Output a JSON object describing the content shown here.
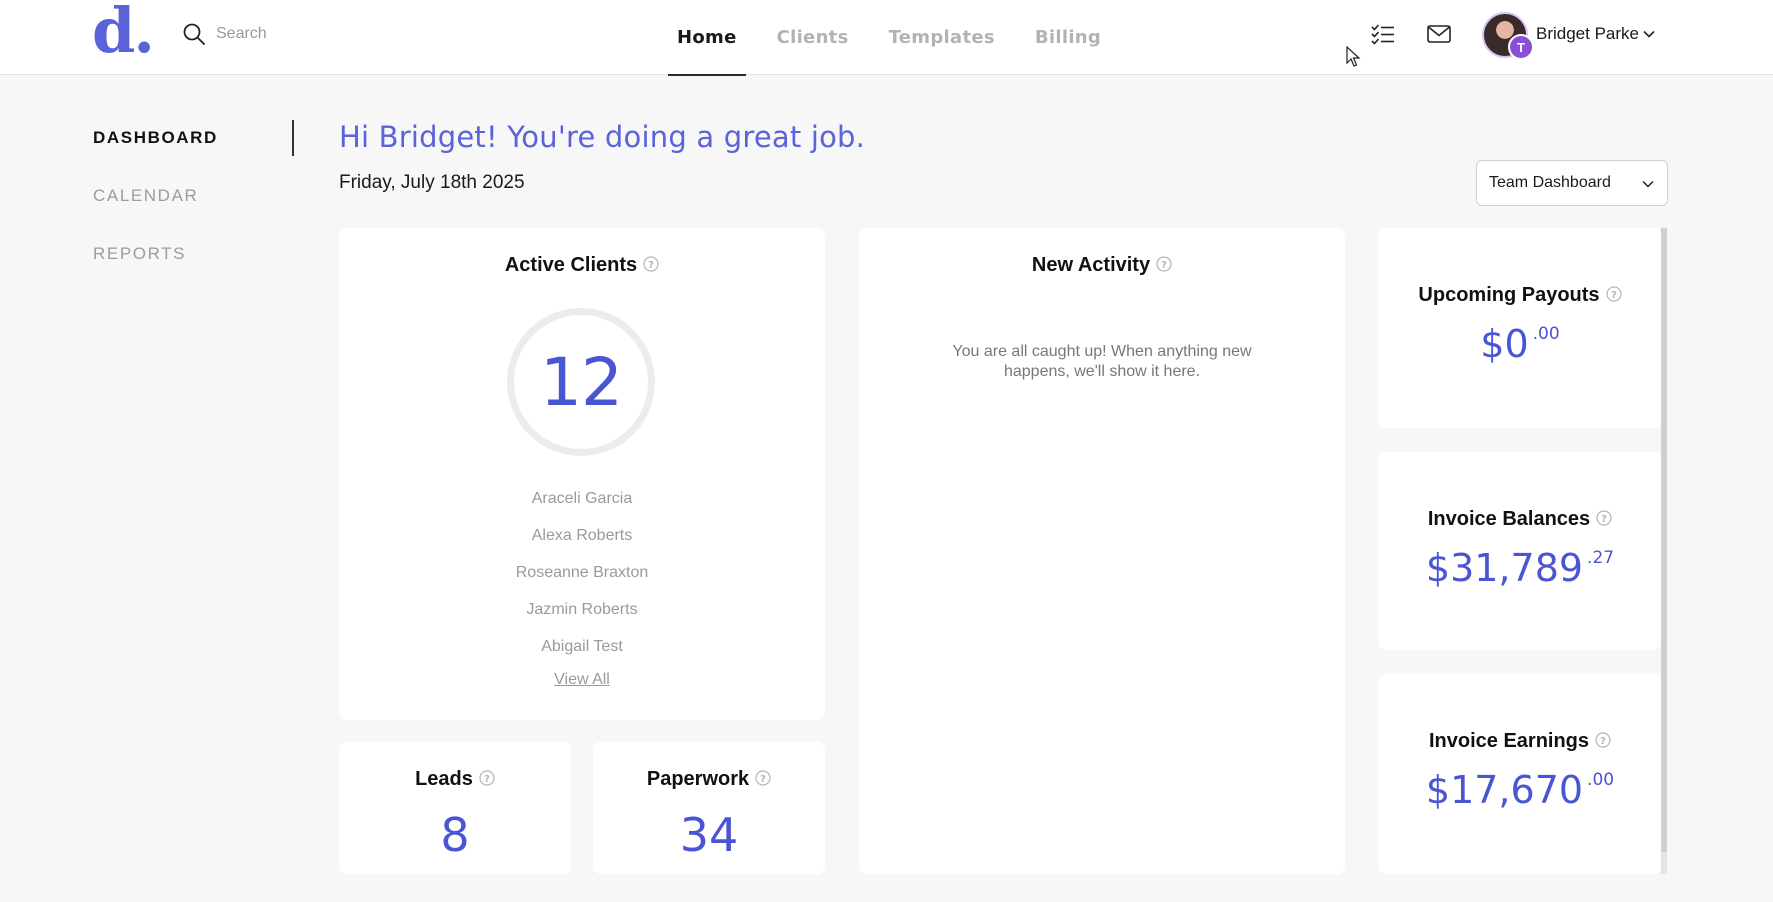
{
  "header": {
    "logo": "d.",
    "search": {
      "placeholder": "Search",
      "value": ""
    },
    "tabs": [
      {
        "label": "Home",
        "active": true
      },
      {
        "label": "Clients",
        "active": false
      },
      {
        "label": "Templates",
        "active": false
      },
      {
        "label": "Billing",
        "active": false
      }
    ],
    "user": {
      "name": "Bridget Parke",
      "badge": "T"
    }
  },
  "sidebar": {
    "items": [
      {
        "label": "DASHBOARD",
        "active": true
      },
      {
        "label": "CALENDAR",
        "active": false
      },
      {
        "label": "REPORTS",
        "active": false
      }
    ]
  },
  "main": {
    "greeting": "Hi Bridget! You're doing a great job.",
    "date": "Friday, July 18th 2025",
    "dashboard_select": "Team Dashboard",
    "active_clients": {
      "title": "Active Clients",
      "count": "12",
      "clients": [
        "Araceli Garcia",
        "Alexa Roberts",
        "Roseanne Braxton",
        "Jazmin Roberts",
        "Abigail Test"
      ],
      "view_all": "View All"
    },
    "new_activity": {
      "title": "New Activity",
      "empty_message": "You are all caught up! When anything new happens, we'll show it here."
    },
    "leads": {
      "title": "Leads",
      "count": "8"
    },
    "paperwork": {
      "title": "Paperwork",
      "count": "34"
    },
    "upcoming_payouts": {
      "title": "Upcoming Payouts",
      "dollars": "$0",
      "cents": ".00"
    },
    "invoice_balances": {
      "title": "Invoice Balances",
      "dollars": "$31,789",
      "cents": ".27"
    },
    "invoice_earnings": {
      "title": "Invoice Earnings",
      "dollars": "$17,670",
      "cents": ".00"
    }
  },
  "colors": {
    "accent": "#5a63d8",
    "number": "#4a55d4",
    "badge": "#8a4fd8"
  },
  "icons": [
    "search-icon",
    "checklist-icon",
    "mail-icon",
    "chevron-down-icon",
    "help-icon",
    "cursor-icon"
  ]
}
